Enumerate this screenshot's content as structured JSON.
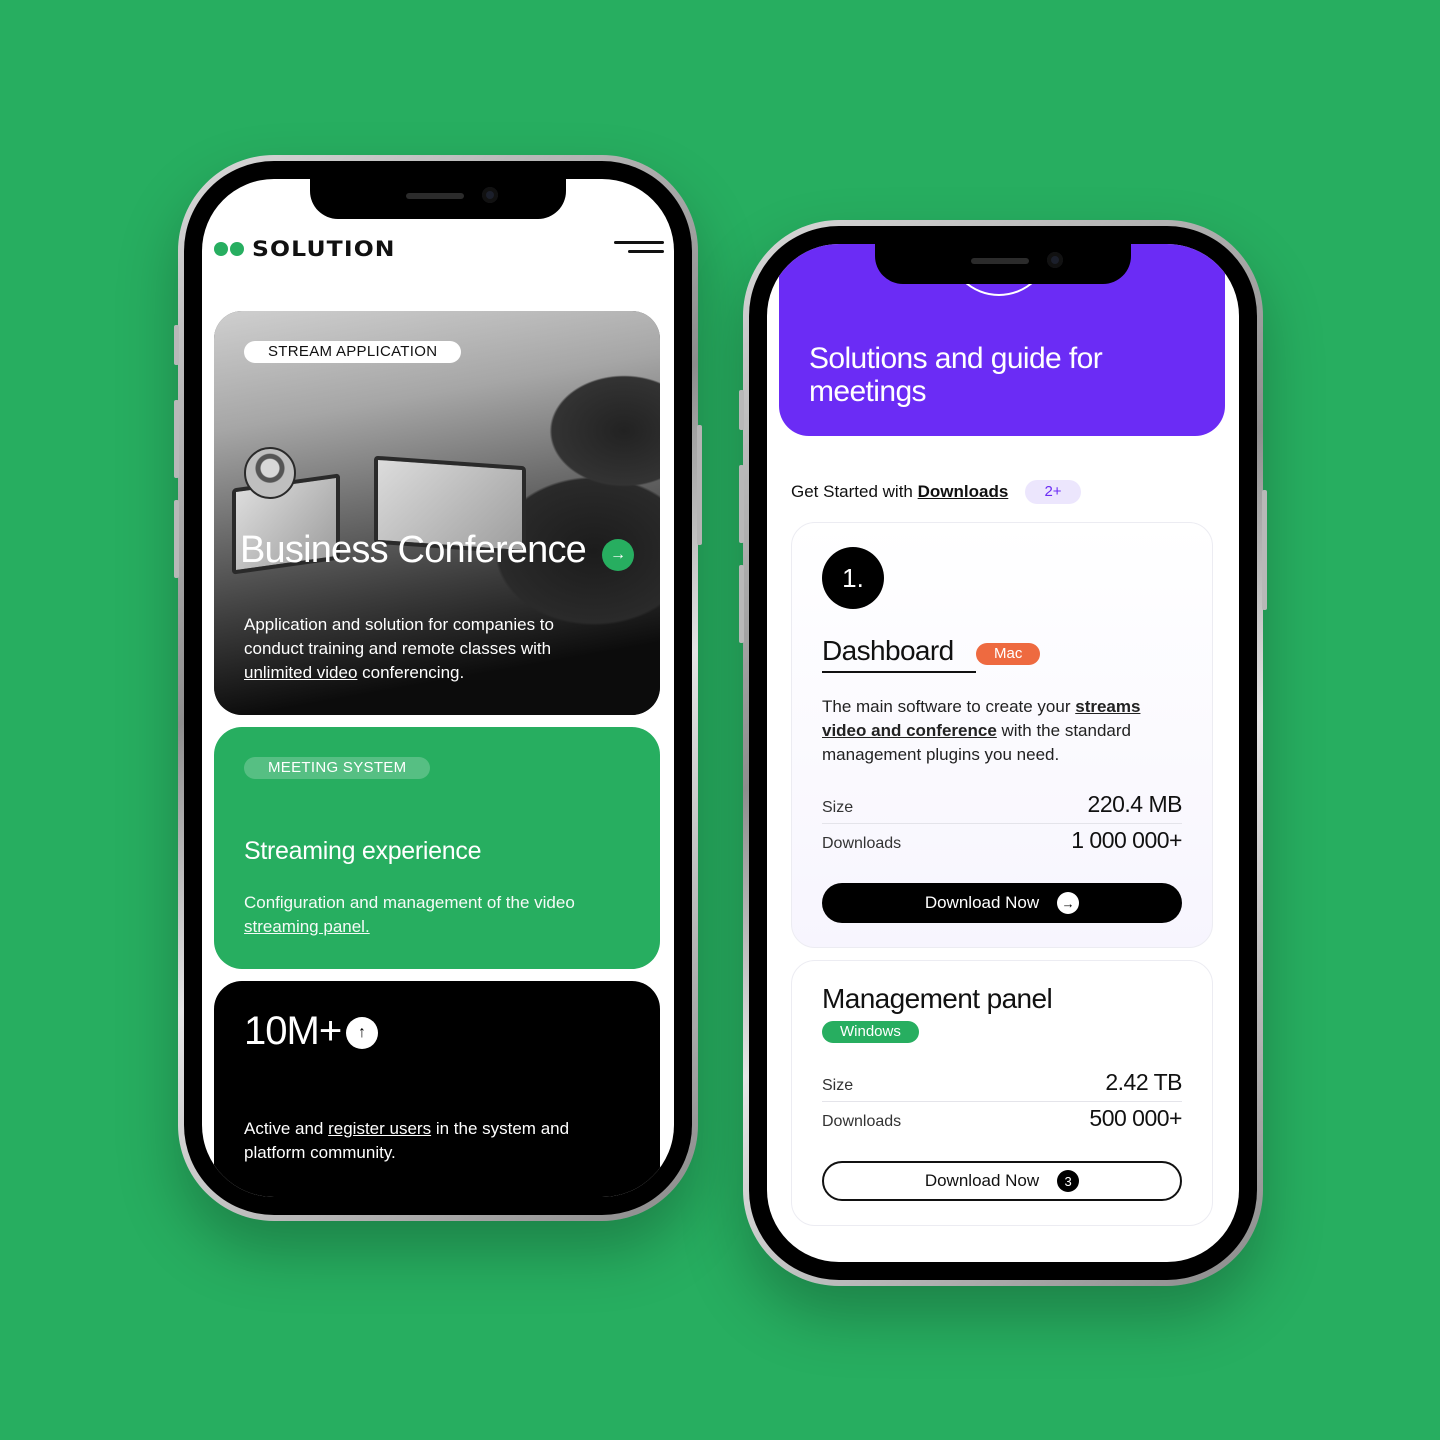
{
  "colors": {
    "background": "#27ae60",
    "accent_green": "#27ae60",
    "accent_purple": "#6b2cf5",
    "mac_tag": "#ee6a40",
    "windows_tag": "#27ae60"
  },
  "left_phone": {
    "brand": "SOLUTION",
    "menu_icon": "hamburger-icon",
    "conference_card": {
      "tag": "STREAM APPLICATION",
      "title": "Business Conference",
      "arrow_icon": "arrow-right-icon",
      "desc_before": "Application and solution for companies to conduct training and remote classes with ",
      "desc_link": "unlimited video",
      "desc_after": " conferencing."
    },
    "streaming_card": {
      "tag": "MEETING SYSTEM",
      "title": "Streaming experience",
      "desc_before": "Configuration and management of the video ",
      "desc_link": "streaming panel."
    },
    "stats_card": {
      "value": "10M+",
      "arrow_icon": "arrow-up-icon",
      "desc_before": "Active and ",
      "desc_link": "register users",
      "desc_after": " in the system and platform community."
    }
  },
  "right_phone": {
    "hero_title": "Solutions and guide for meetings",
    "get_started_prefix": "Get Started with ",
    "get_started_link": "Downloads",
    "downloads_count": "2+",
    "cards": [
      {
        "number": "1.",
        "title": "Dashboard",
        "os": "Mac",
        "desc_before": "The main software to create your ",
        "desc_link": "streams video and conference",
        "desc_after": " with the standard management plugins you need.",
        "size_label": "Size",
        "size": "220.4 MB",
        "downloads_label": "Downloads",
        "downloads": "1 000 000+",
        "button_label": "Download Now",
        "button_icon": "arrow-right-icon"
      },
      {
        "title": "Management panel",
        "os": "Windows",
        "size_label": "Size",
        "size": "2.42 TB",
        "downloads_label": "Downloads",
        "downloads": "500 000+",
        "button_label": "Download Now",
        "button_badge": "3"
      }
    ]
  }
}
